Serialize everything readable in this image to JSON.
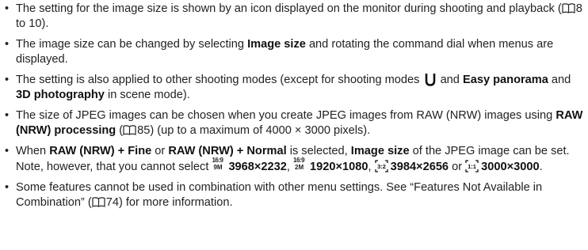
{
  "bullet_glyph": "•",
  "book_icon": "reference-book-icon",
  "items": [
    {
      "a": "The setting for the image size is shown by an icon displayed on the monitor during shooting and playback (",
      "ref": "8 to 10",
      "b": ")."
    },
    {
      "a": "The image size can be changed by selecting ",
      "bold1": "Image size",
      "b": " and rotating the command dial when menus are displayed."
    },
    {
      "a": "The setting is also applied to other shooting modes (except for shooting modes ",
      "mode_icon": "user-mode-u-icon",
      "b": " and ",
      "bold1": "Easy panorama",
      "c": " and ",
      "bold2": "3D photography",
      "d": " in scene mode)."
    },
    {
      "a": "The size of JPEG images can be chosen when you create JPEG images from RAW (NRW) images using ",
      "bold1": "RAW (NRW) processing",
      "b": " (",
      "ref": "85",
      "c": ") (up to a maximum of 4000 × 3000 pixels)."
    },
    {
      "a": "When ",
      "bold1": "RAW (NRW) + Fine",
      "b": " or ",
      "bold2": "RAW (NRW) + Normal",
      "c": " is selected, ",
      "bold3": "Image size",
      "d": " of the JPEG image can be set. Note, however, that you cannot select ",
      "sizes": [
        {
          "icon_top": "16:9",
          "icon_bottom": "9M",
          "label": "3968×2232"
        },
        {
          "icon_top": "16:9",
          "icon_bottom": "2M",
          "label": "1920×1080"
        },
        {
          "icon_top": "3:2",
          "icon_bottom": "",
          "label": "3984×2656"
        },
        {
          "icon_top": "1:1",
          "icon_bottom": "",
          "label": "3000×3000"
        }
      ],
      "sep1": ", ",
      "sep2": ", ",
      "sep3": " or ",
      "end": "."
    },
    {
      "a": "Some features cannot be used in combination with other menu settings. See “Features Not Available in Combination” (",
      "ref": "74",
      "b": ") for more information."
    }
  ]
}
